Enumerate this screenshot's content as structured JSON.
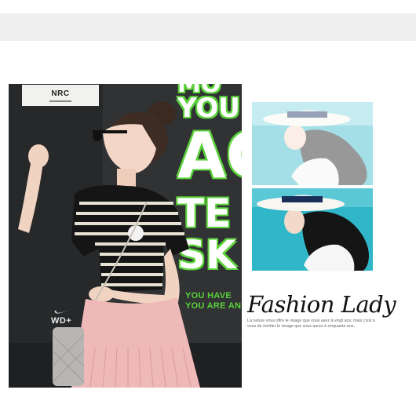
{
  "brand_card": {
    "label": "NRC"
  },
  "poster": {
    "words": [
      "MO",
      "YOU",
      "AC",
      "TE",
      "SK"
    ],
    "taglines": [
      "YOU HAVE",
      "YOU ARE AN"
    ]
  },
  "nike": {
    "label": "WD+"
  },
  "caption": {
    "title": "Fashion Lady",
    "body": "La nature vous offre le visage que vous avez à vingt ans, mais c'est à vous de mériter le visage que vous aurez à cinquante ans."
  },
  "colors": {
    "poster_green": "#5bd23a",
    "top_band": "#efefef",
    "sea": "#35b8c9",
    "skirt": "#efb9b8"
  }
}
